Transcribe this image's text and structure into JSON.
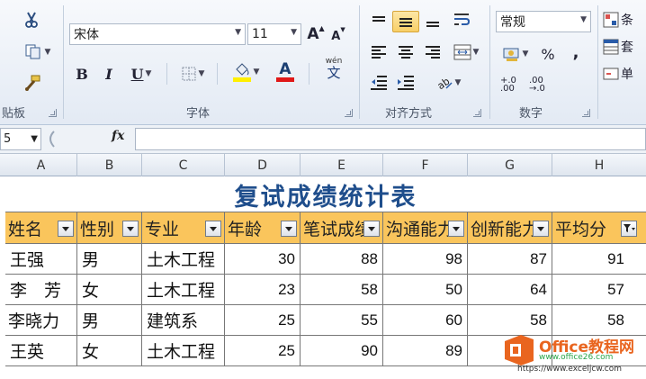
{
  "ribbon": {
    "clipboard": {
      "label": "贴板"
    },
    "font": {
      "label": "字体",
      "font_name": "宋体",
      "font_size": "11",
      "grow_label": "A",
      "shrink_label": "A",
      "bold": "B",
      "italic": "I",
      "underline": "U",
      "font_color_letter": "A",
      "phonetic_glyph": "文",
      "phonetic_top": "wén"
    },
    "alignment": {
      "label": "对齐方式"
    },
    "number": {
      "label": "数字",
      "format": "常规",
      "percent": "%",
      "comma": ",",
      "inc_decimal": "+.0 .00",
      "dec_decimal": ".00 →.0"
    },
    "styles": {
      "items": [
        "条",
        "套",
        "单"
      ]
    },
    "tail_label": "条"
  },
  "formula_bar": {
    "name_box": "5",
    "fx": "fx"
  },
  "grid": {
    "columns": [
      "A",
      "B",
      "C",
      "D",
      "E",
      "F",
      "G",
      "H"
    ],
    "title": "复试成绩统计表",
    "headers": [
      "姓名",
      "性别",
      "专业",
      "年龄",
      "笔试成绩",
      "沟通能力",
      "创新能力",
      "平均分"
    ],
    "rows": [
      [
        "王强",
        "男",
        "土木工程",
        "30",
        "88",
        "98",
        "87",
        "91"
      ],
      [
        "李　芳",
        "女",
        "土木工程",
        "23",
        "58",
        "50",
        "64",
        "57"
      ],
      [
        "李晓力",
        "男",
        "建筑系",
        "25",
        "55",
        "60",
        "58",
        "58"
      ],
      [
        "王英",
        "女",
        "土木工程",
        "25",
        "90",
        "89",
        "",
        ""
      ]
    ]
  },
  "watermark": {
    "brand": "Office教程网",
    "url": "www.office26.com",
    "site": "https://www.exceljcw.com"
  },
  "colors": {
    "header_fill": "#fac55c",
    "title": "#1f4e8c",
    "ribbon": "#e3eaf4"
  }
}
